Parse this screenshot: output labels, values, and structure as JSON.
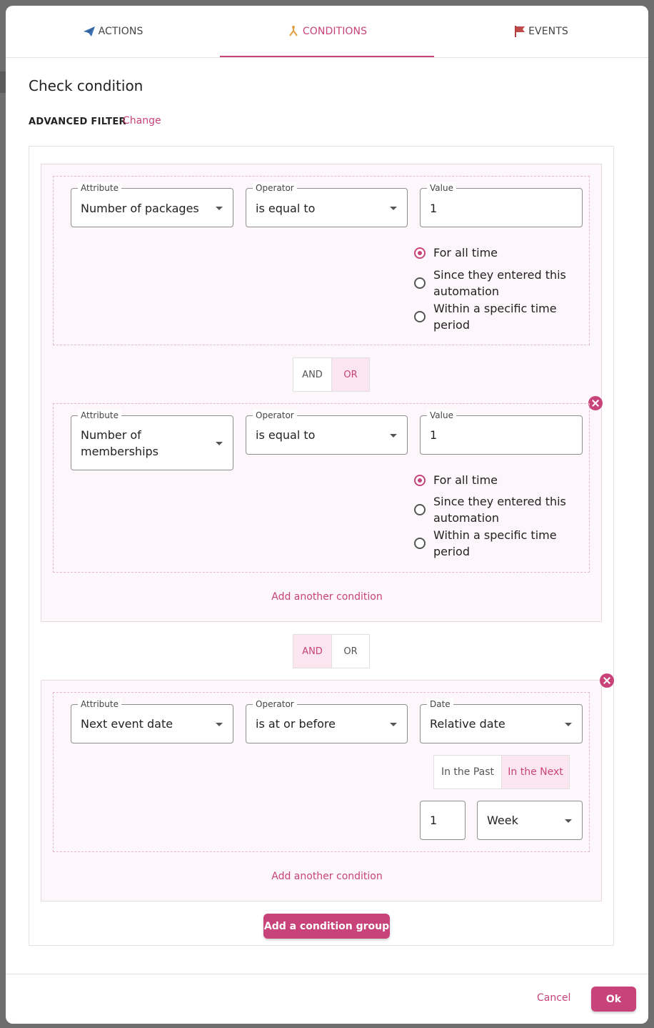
{
  "tabs": [
    {
      "label": "ACTIONS",
      "icon": "paper-plane-icon"
    },
    {
      "label": "CONDITIONS",
      "icon": "branch-icon"
    },
    {
      "label": "EVENTS",
      "icon": "flag-icon"
    }
  ],
  "active_tab": "CONDITIONS",
  "title": "Check condition",
  "filter": {
    "label": "ADVANCED FILTER",
    "change": "Change"
  },
  "group1": {
    "cond1": {
      "attribute_legend": "Attribute",
      "attribute": "Number of packages",
      "operator_legend": "Operator",
      "operator": "is equal to",
      "value_legend": "Value",
      "value": "1",
      "radios": [
        "For all time",
        "Since they entered this automation",
        "Within a specific time period"
      ],
      "selected_radio": 0
    },
    "join": {
      "and": "AND",
      "or": "OR",
      "selected": "OR"
    },
    "cond2": {
      "attribute_legend": "Attribute",
      "attribute": "Number of memberships",
      "operator_legend": "Operator",
      "operator": "is equal to",
      "value_legend": "Value",
      "value": "1",
      "radios": [
        "For all time",
        "Since they entered this automation",
        "Within a specific time period"
      ],
      "selected_radio": 0
    },
    "add_condition": "Add another condition"
  },
  "group_join": {
    "and": "AND",
    "or": "OR",
    "selected": "AND"
  },
  "group2": {
    "cond1": {
      "attribute_legend": "Attribute",
      "attribute": "Next event date",
      "operator_legend": "Operator",
      "operator": "is at or before",
      "date_legend": "Date",
      "date": "Relative date",
      "past_label": "In the Past",
      "next_label": "In the Next",
      "selected_direction": "In the Next",
      "amount": "1",
      "unit": "Week"
    },
    "add_condition": "Add another condition"
  },
  "add_group": "Add a condition group",
  "footer": {
    "cancel": "Cancel",
    "ok": "Ok"
  },
  "colors": {
    "accent": "#c8437a",
    "group_bg": "#fdf6fa",
    "toggle_on_bg": "#fbe6ef"
  }
}
